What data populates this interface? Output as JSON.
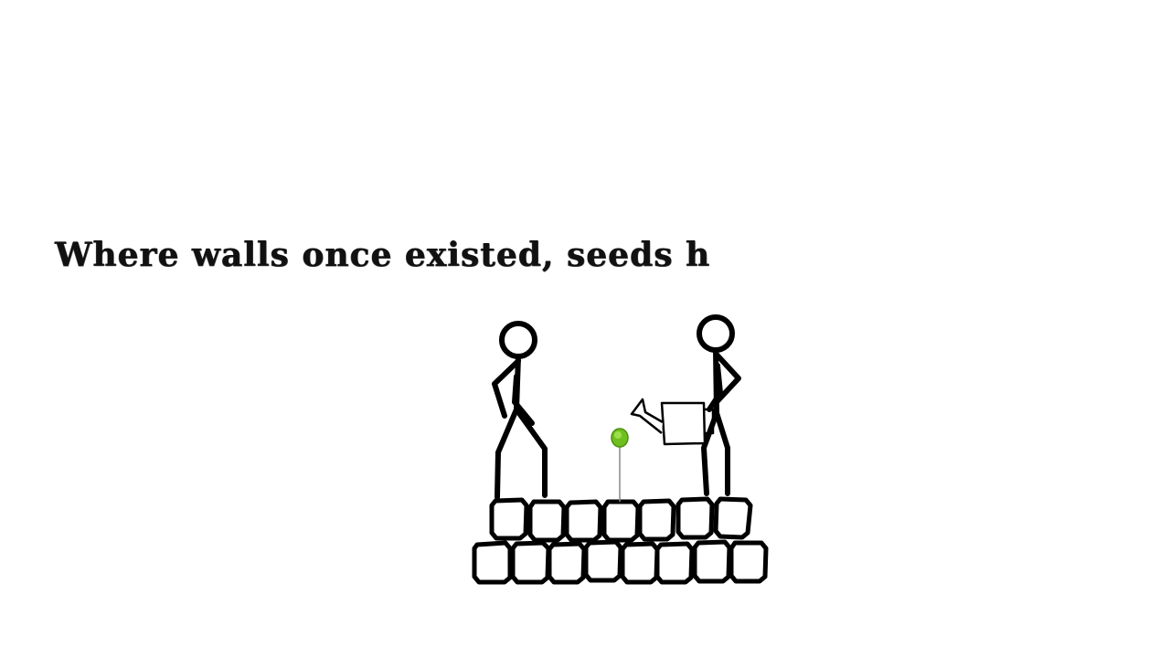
{
  "narration": {
    "text": "Where walls once existed, seeds h"
  },
  "scene": {
    "line_color": "#000000",
    "sprout_color": "#6fbf1f",
    "sprout_highlight": "#9be04a",
    "stem_color": "#888888"
  }
}
